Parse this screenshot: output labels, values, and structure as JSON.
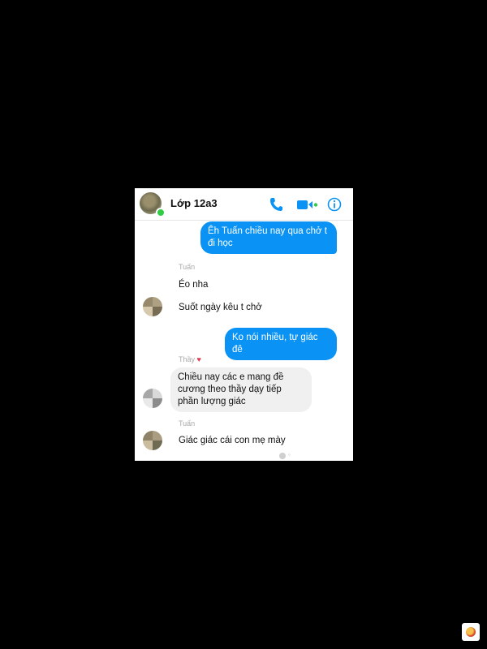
{
  "header": {
    "title": "Lớp 12a3",
    "icons": [
      "phone-icon",
      "video-icon",
      "info-icon"
    ],
    "accent": "#0a93f5",
    "online_color": "#31cc46"
  },
  "messages": [
    {
      "type": "outgoing",
      "text": "Êh Tuấn chiều nay qua chở t đi học"
    },
    {
      "type": "sender",
      "text": "Tuấn"
    },
    {
      "type": "incoming",
      "text": "Éo nha"
    },
    {
      "type": "incoming",
      "text": "Suốt ngày kêu t chở"
    },
    {
      "type": "outgoing",
      "text": "Ko nói nhiều, tự giác đê"
    },
    {
      "type": "sender",
      "text": "Thầy"
    },
    {
      "type": "incoming",
      "text": "Chiều nay các e mang đề cương theo thầy dạy tiếp phần lượng giác"
    },
    {
      "type": "sender",
      "text": "Tuấn"
    },
    {
      "type": "incoming",
      "text": "Giác giác cái con mẹ mày"
    }
  ]
}
